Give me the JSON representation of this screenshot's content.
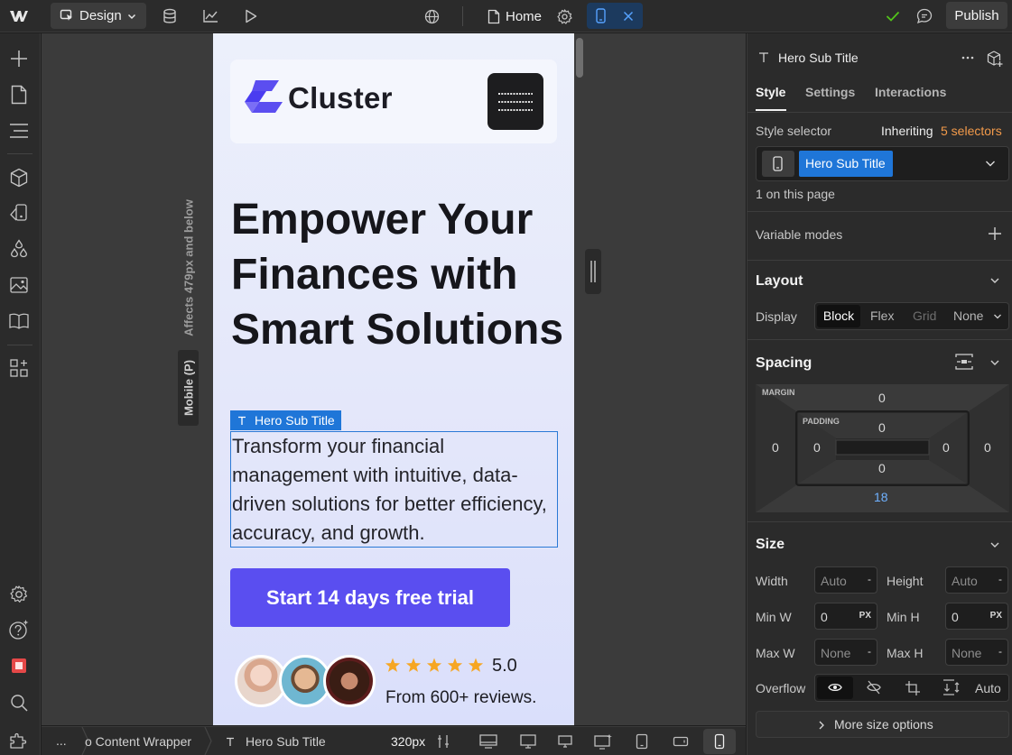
{
  "topbar": {
    "mode_label": "Design",
    "page_label": "Home",
    "publish_label": "Publish"
  },
  "canvas": {
    "affects_label": "Affects 479px and below",
    "breakpoint_label": "Mobile (P)",
    "brand_name": "Cluster",
    "hero_title": "Empower Your Finances with Smart Solutions",
    "selected_element_label": "Hero Sub Title",
    "hero_subtitle": "Transform your financial management with intuitive, data-driven solutions for better efficiency, accuracy, and growth.",
    "cta_label": "Start 14 days free trial",
    "rating_value": "5.0",
    "rating_stars": 5,
    "reviews_label": "From 600+ reviews."
  },
  "bottombar": {
    "more_label": "...",
    "crumb_parent": "o Content Wrapper",
    "crumb_current": "Hero Sub Title",
    "width_label": "320px"
  },
  "panel": {
    "element_name": "Hero Sub Title",
    "tabs": [
      "Style",
      "Settings",
      "Interactions"
    ],
    "style_selector_label": "Style selector",
    "inheriting_label": "Inheriting",
    "inheriting_count": "5 selectors",
    "selector_chip": "Hero Sub Title",
    "on_page_label": "1 on this page",
    "variable_modes_label": "Variable modes",
    "layout": {
      "title": "Layout",
      "display_label": "Display",
      "options": [
        "Block",
        "Flex",
        "Grid",
        "None"
      ]
    },
    "spacing": {
      "title": "Spacing",
      "margin_label": "MARGIN",
      "padding_label": "PADDING",
      "margin_top": "0",
      "margin_left": "0",
      "margin_right": "0",
      "margin_bottom": "18",
      "padding_top": "0",
      "padding_left": "0",
      "padding_right": "0",
      "padding_bottom": "0"
    },
    "size": {
      "title": "Size",
      "width_label": "Width",
      "width_value": "Auto",
      "height_label": "Height",
      "height_value": "Auto",
      "min_w_label": "Min W",
      "min_w_value": "0",
      "min_h_label": "Min H",
      "min_h_value": "0",
      "max_w_label": "Max W",
      "max_w_value": "None",
      "max_h_label": "Max H",
      "max_h_value": "None",
      "unit_dash": "-",
      "unit_px": "PX",
      "overflow_label": "Overflow",
      "overflow_auto": "Auto",
      "more_label": "More size options"
    }
  },
  "colors": {
    "accent": "#1f76d8",
    "cta": "#5a4ef0",
    "brand": "#5b4ef0",
    "star": "#f6a623",
    "inheriting": "#f29a4a",
    "check": "#52c41a"
  },
  "icons": [
    "webflow-logo-icon",
    "cursor-icon",
    "database-icon",
    "chart-icon",
    "play-icon",
    "globe-icon",
    "page-icon",
    "gear-icon",
    "mobile-icon",
    "close-icon",
    "check-icon",
    "comment-icon",
    "plus-icon",
    "pages-icon",
    "navigator-icon",
    "cube-icon",
    "assets-icon",
    "drops-icon",
    "image-icon",
    "book-icon",
    "apps-icon",
    "settings-icon",
    "help-icon",
    "record-icon",
    "search-icon",
    "puzzle-icon",
    "text-icon",
    "more-icon",
    "box-add-icon",
    "chevron-down-icon",
    "eye-icon",
    "eye-off-icon",
    "crop-icon",
    "scroll-icon",
    "desktop-icon",
    "laptop-icon",
    "tablet-icon"
  ]
}
